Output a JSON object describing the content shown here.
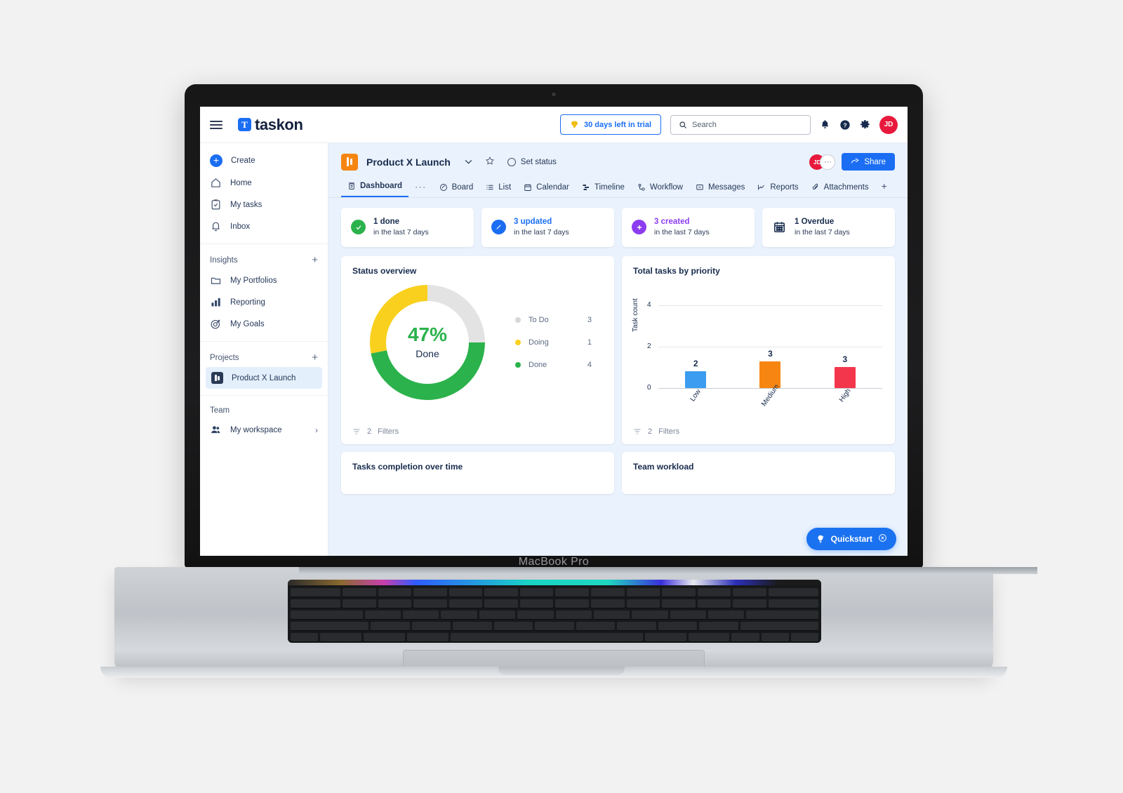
{
  "device": {
    "model_label": "MacBook Pro"
  },
  "topbar": {
    "menu_icon": "hamburger-icon",
    "brand_mark": "T",
    "brand_name": "taskon",
    "trial": {
      "icon": "diamond-icon",
      "label": "30 days left in trial"
    },
    "search": {
      "icon": "search-icon",
      "placeholder": "Search"
    },
    "icons": [
      "bell-icon",
      "help-icon",
      "gear-icon"
    ],
    "avatar_initials": "JD"
  },
  "sidebar": {
    "primary": [
      {
        "icon": "plus-circle-icon",
        "label": "Create"
      },
      {
        "icon": "home-icon",
        "label": "Home"
      },
      {
        "icon": "clipboard-check-icon",
        "label": "My tasks"
      },
      {
        "icon": "bell-icon",
        "label": "Inbox"
      }
    ],
    "insights": {
      "header": "Insights",
      "add": "+",
      "items": [
        {
          "icon": "folder-icon",
          "label": "My Portfolios"
        },
        {
          "icon": "bar-chart-icon",
          "label": "Reporting"
        },
        {
          "icon": "target-icon",
          "label": "My Goals"
        }
      ]
    },
    "projects": {
      "header": "Projects",
      "add": "+",
      "items": [
        {
          "icon": "board-icon",
          "label": "Product X Launch",
          "active": true
        }
      ]
    },
    "team": {
      "header": "Team",
      "items": [
        {
          "icon": "people-icon",
          "label": "My workspace",
          "chevron": "›"
        }
      ]
    }
  },
  "project": {
    "icon": "board-icon",
    "title": "Product X Launch",
    "chevron": "⌄",
    "star_icon": "star-icon",
    "set_status": {
      "icon": "status-ring-icon",
      "label": "Set status"
    },
    "members": {
      "avatar_initials": "JD",
      "more": "···"
    },
    "share": {
      "icon": "share-icon",
      "label": "Share"
    }
  },
  "tabs": {
    "items": [
      {
        "icon": "dashboard-icon",
        "label": "Dashboard",
        "active": true
      },
      {
        "icon": "board-circle-icon",
        "label": "Board",
        "active": false
      },
      {
        "icon": "list-icon",
        "label": "List",
        "active": false
      },
      {
        "icon": "calendar-icon",
        "label": "Calendar",
        "active": false
      },
      {
        "icon": "timeline-icon",
        "label": "Timeline",
        "active": false
      },
      {
        "icon": "workflow-icon",
        "label": "Workflow",
        "active": false
      },
      {
        "icon": "messages-icon",
        "label": "Messages",
        "active": false
      },
      {
        "icon": "reports-icon",
        "label": "Reports",
        "active": false
      },
      {
        "icon": "attachment-icon",
        "label": "Attachments",
        "active": false
      }
    ],
    "overflow": "···",
    "add": "+"
  },
  "stats": [
    {
      "icon": "check-circle-icon",
      "color": "#2bb24c",
      "title": "1 done",
      "title_color": "#172b4d",
      "subtitle": "in the last 7 days"
    },
    {
      "icon": "pencil-circle-icon",
      "color": "#1b6ef3",
      "title": "3 updated",
      "title_color": "#1b6ef3",
      "subtitle": "in the last 7 days"
    },
    {
      "icon": "plus-circle-icon",
      "color": "#8c3df0",
      "title": "3 created",
      "title_color": "#8c3df0",
      "subtitle": "in the last 7 days"
    },
    {
      "icon": "calendar-icon",
      "color": "#172b4d",
      "title": "1 Overdue",
      "title_color": "#172b4d",
      "subtitle": "in the last 7 days"
    }
  ],
  "status_overview": {
    "title": "Status overview",
    "center_value": "47%",
    "center_label": "Done",
    "filters": {
      "icon": "filter-icon",
      "count": "2",
      "label": "Filters"
    }
  },
  "priority_card": {
    "title": "Total tasks by priority",
    "filters": {
      "icon": "filter-icon",
      "count": "2",
      "label": "Filters"
    }
  },
  "quickstart": {
    "icon": "lightbulb-icon",
    "label": "Quickstart",
    "close_icon": "close-circle-icon"
  },
  "bottom_cards": [
    {
      "title": "Tasks completion over time"
    },
    {
      "title": "Team workload"
    }
  ],
  "colors": {
    "brand_blue": "#1b6ef3",
    "green": "#2bb24c",
    "yellow": "#f9d01e",
    "grey": "#e3e3e3",
    "orange": "#f68511",
    "red": "#f4364c",
    "blue_bar": "#3c9cf0",
    "purple": "#8c3df0",
    "main_bg": "#eaf2fd"
  },
  "chart_data": [
    {
      "type": "pie",
      "title": "Status overview",
      "labels": [
        "To Do",
        "Doing",
        "Done"
      ],
      "values": [
        3,
        1,
        4
      ],
      "colors": [
        "#e3e3e3",
        "#f9d01e",
        "#2bb24c"
      ],
      "center_value": "47%",
      "center_label": "Done",
      "legend_position": "right",
      "donut": true
    },
    {
      "type": "bar",
      "title": "Total tasks by priority",
      "categories": [
        "Low",
        "Medium",
        "High"
      ],
      "values": [
        2,
        3,
        3
      ],
      "bar_colors": [
        "#3c9cf0",
        "#f68511",
        "#f4364c"
      ],
      "xlabel": "",
      "ylabel": "Task count",
      "ylim": [
        0,
        4
      ],
      "yticks": [
        0,
        2,
        4
      ],
      "grid": true,
      "data_labels": [
        "2",
        "3",
        "3"
      ]
    }
  ]
}
